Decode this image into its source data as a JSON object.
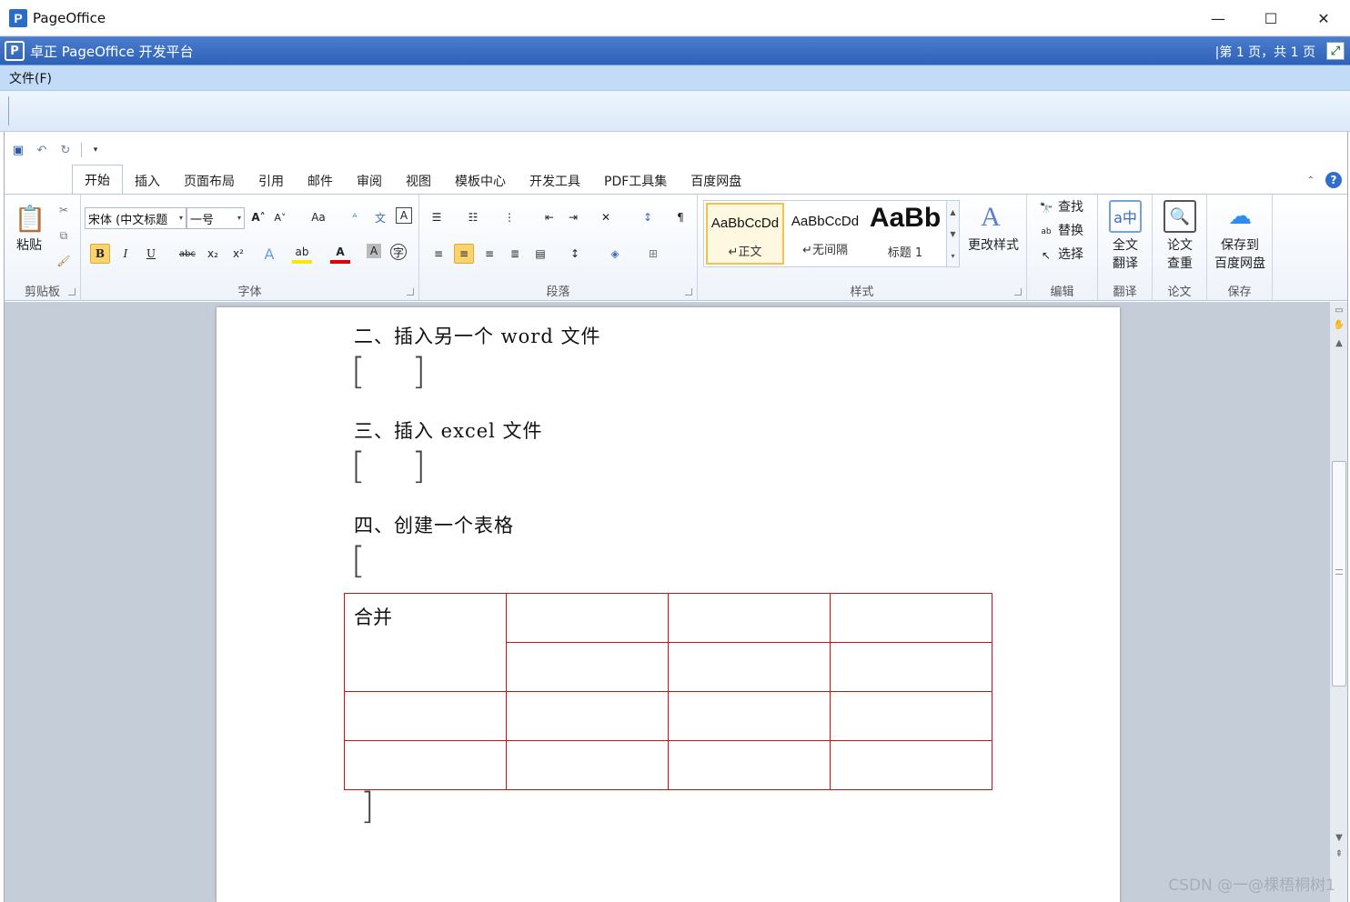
{
  "window": {
    "title": "PageOffice",
    "controls": [
      "—",
      "☐",
      "✕"
    ]
  },
  "po_bar": {
    "title": "卓正 PageOffice 开发平台",
    "page_info": "|第 1 页，共 1 页"
  },
  "menubar": {
    "file_menu": "文件(F)"
  },
  "qat": {
    "items": [
      "save",
      "undo",
      "redo",
      "customize"
    ]
  },
  "tabs": [
    "开始",
    "插入",
    "页面布局",
    "引用",
    "邮件",
    "审阅",
    "视图",
    "模板中心",
    "开发工具",
    "PDF工具集",
    "百度网盘"
  ],
  "ribbon": {
    "clipboard": {
      "paste": "粘贴",
      "label": "剪贴板"
    },
    "font": {
      "font_name": "宋体 (中文标题",
      "font_size": "一号",
      "label": "字体",
      "bold": "B",
      "italic": "I",
      "underline": "U",
      "strike": "abc",
      "sub": "x₂",
      "sup": "x²",
      "grow": "A˄",
      "shrink": "A˅",
      "change_case": "Aa"
    },
    "paragraph": {
      "label": "段落"
    },
    "styles": {
      "label": "样式",
      "items": [
        {
          "sample": "AaBbCcDd",
          "name": "↵正文"
        },
        {
          "sample": "AaBbCcDd",
          "name": "↵无间隔"
        },
        {
          "sample": "AaBb",
          "name": "标题 1"
        }
      ],
      "change_styles": "更改样式"
    },
    "editing": {
      "find": "查找",
      "replace": "替换",
      "select": "选择",
      "label": "编辑"
    },
    "translate": {
      "full_text": "全文",
      "translate": "翻译",
      "label": "翻译"
    },
    "paper": {
      "paper": "论文",
      "check": "查重",
      "label": "论文"
    },
    "save": {
      "save_to": "保存到",
      "baidu": "百度网盘",
      "label": "保存"
    }
  },
  "document": {
    "headings": [
      "二、插入另一个 word 文件",
      "三、插入 excel 文件",
      "四、创建一个表格"
    ],
    "table_merged_cell": "合并"
  },
  "watermark": "CSDN @一@棵梧桐树1"
}
